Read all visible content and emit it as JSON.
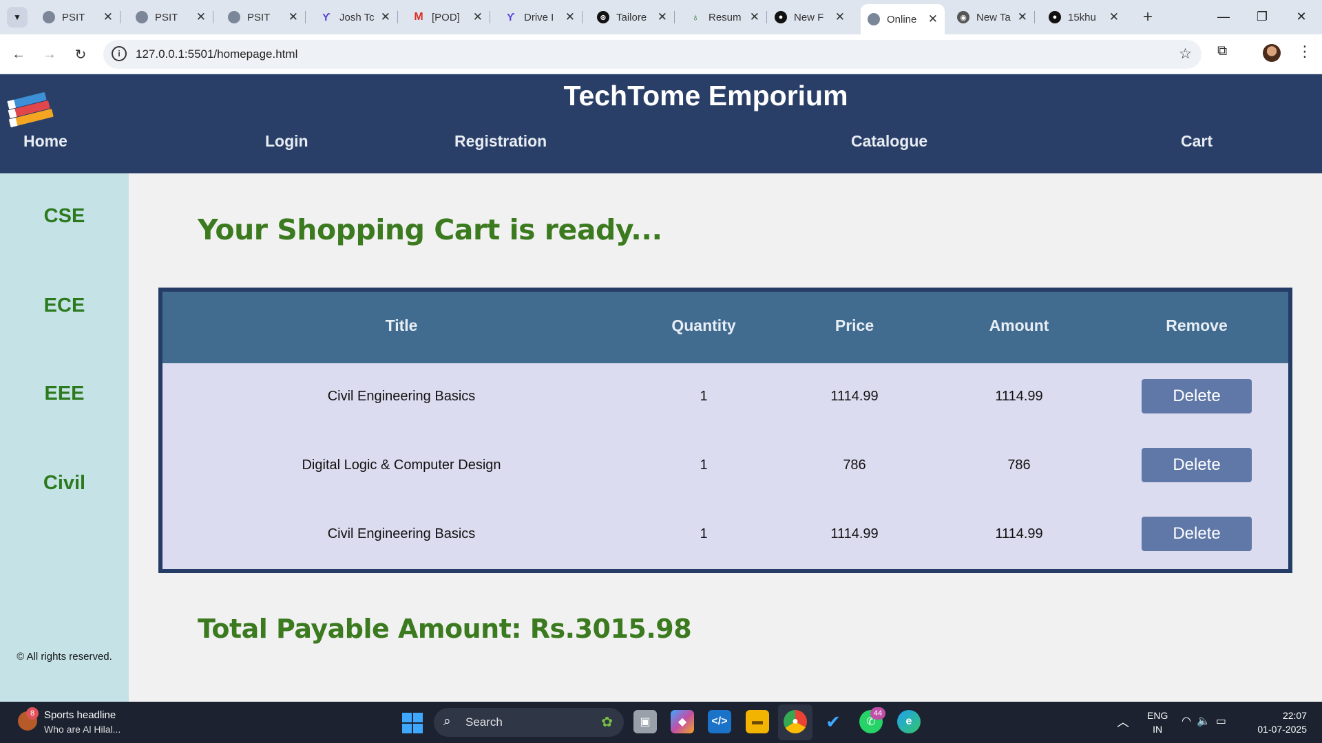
{
  "browser": {
    "tabs": [
      {
        "label": "PSIT",
        "favicon": "globe-icon",
        "color": "#7b8699"
      },
      {
        "label": "PSIT",
        "favicon": "globe-icon",
        "color": "#7b8699"
      },
      {
        "label": "PSIT",
        "favicon": "globe-icon",
        "color": "#7b8699"
      },
      {
        "label": "Josh Tc",
        "favicon": "wing-icon",
        "color": "#5a3fd6"
      },
      {
        "label": "[POD]",
        "favicon": "gmail-icon",
        "color": "#d93025"
      },
      {
        "label": "Drive I",
        "favicon": "wing-icon",
        "color": "#5a3fd6"
      },
      {
        "label": "Tailore",
        "favicon": "openai-icon",
        "color": "#111111"
      },
      {
        "label": "Resum",
        "favicon": "leaf-icon",
        "color": "#2e7d32"
      },
      {
        "label": "New F",
        "favicon": "github-icon",
        "color": "#111111"
      },
      {
        "label": "Online",
        "favicon": "globe-icon",
        "color": "#7b8699",
        "active": true
      },
      {
        "label": "New Ta",
        "favicon": "chrome-icon",
        "color": "#555555"
      },
      {
        "label": "15khu",
        "favicon": "github-icon",
        "color": "#111111"
      }
    ],
    "url": "127.0.0.1:5501/homepage.html"
  },
  "site": {
    "title": "TechTome Emporium",
    "nav": {
      "home": "Home",
      "login": "Login",
      "registration": "Registration",
      "catalogue": "Catalogue",
      "cart": "Cart"
    },
    "sidebar": [
      "CSE",
      "ECE",
      "EEE",
      "Civil"
    ],
    "copyright": "© All rights reserved."
  },
  "cart": {
    "heading": "Your Shopping Cart is ready...",
    "columns": [
      "Title",
      "Quantity",
      "Price",
      "Amount",
      "Remove"
    ],
    "rows": [
      {
        "title": "Civil Engineering Basics",
        "quantity": "1",
        "price": "1114.99",
        "amount": "1114.99",
        "action": "Delete"
      },
      {
        "title": "Digital Logic & Computer Design",
        "quantity": "1",
        "price": "786",
        "amount": "786",
        "action": "Delete"
      },
      {
        "title": "Civil Engineering Basics",
        "quantity": "1",
        "price": "1114.99",
        "amount": "1114.99",
        "action": "Delete"
      }
    ],
    "total": "Total Payable Amount: Rs.3015.98"
  },
  "taskbar": {
    "news_badge": "8",
    "news_title": "Sports headline",
    "news_sub": "Who are Al Hilal...",
    "search_label": "Search",
    "whatsapp_badge": "44",
    "lang_line1": "ENG",
    "lang_line2": "IN",
    "time": "22:07",
    "date": "01-07-2025"
  },
  "colors": {
    "header_bg": "#2a3f68",
    "sidebar_bg": "#c5e3e7",
    "accent_green": "#3b7a1e",
    "table_head": "#416c90",
    "table_body": "#dcdcf0",
    "delete_btn": "#6078a8"
  }
}
